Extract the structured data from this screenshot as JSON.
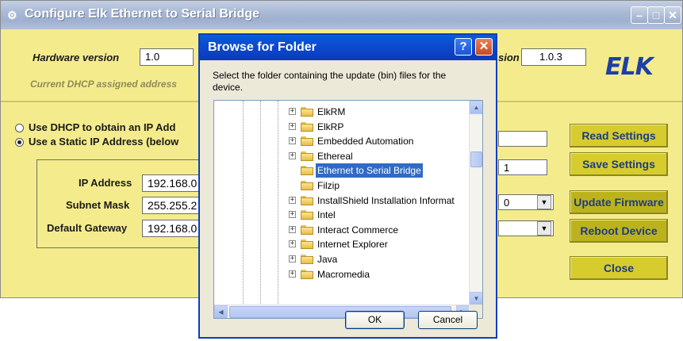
{
  "main_window": {
    "title": "Configure Elk Ethernet to Serial Bridge",
    "hardware_version_label": "Hardware version",
    "hardware_version_value": "1.0",
    "firmware_version_label_partial": "sion",
    "firmware_version_value": "1.0.3",
    "logo_text": "ELK",
    "dhcp_note": "Current DHCP assigned address",
    "radio_dhcp_label": "Use DHCP to obtain an IP Add",
    "radio_static_label": "Use a Static IP Address (below",
    "ip_address_label": "IP Address",
    "ip_address_value": "192.168.0",
    "subnet_mask_label": "Subnet Mask",
    "subnet_mask_value": "255.255.2",
    "default_gateway_label": "Default Gateway",
    "default_gateway_value": "192.168.0",
    "right_field_2_value": "1",
    "right_field_3_value": "0",
    "buttons": {
      "read_settings": "Read Settings",
      "save_settings": "Save Settings",
      "update_firmware": "Update Firmware",
      "reboot_device": "Reboot Device",
      "close": "Close"
    },
    "colors": {
      "window_bg": "#f4ec8c",
      "button_bg": "#d6cc2e",
      "button_text": "#1d3b86"
    }
  },
  "dialog": {
    "title": "Browse for Folder",
    "instruction": "Select the folder containing the update (bin) files for the device.",
    "tree_items": [
      {
        "label": "ElkRM",
        "expandable": true,
        "selected": false
      },
      {
        "label": "ElkRP",
        "expandable": true,
        "selected": false
      },
      {
        "label": "Embedded Automation",
        "expandable": true,
        "selected": false
      },
      {
        "label": "Ethereal",
        "expandable": true,
        "selected": false
      },
      {
        "label": "Ethernet to Serial Bridge",
        "expandable": false,
        "selected": true
      },
      {
        "label": "Filzip",
        "expandable": false,
        "selected": false
      },
      {
        "label": "InstallShield Installation Informat",
        "expandable": true,
        "selected": false
      },
      {
        "label": "Intel",
        "expandable": true,
        "selected": false
      },
      {
        "label": "Interact Commerce",
        "expandable": true,
        "selected": false
      },
      {
        "label": "Internet Explorer",
        "expandable": true,
        "selected": false
      },
      {
        "label": "Java",
        "expandable": true,
        "selected": false
      },
      {
        "label": "Macromedia",
        "expandable": true,
        "selected": false
      }
    ],
    "ok_label": "OK",
    "cancel_label": "Cancel",
    "help_glyph": "?",
    "close_glyph": "✕"
  }
}
